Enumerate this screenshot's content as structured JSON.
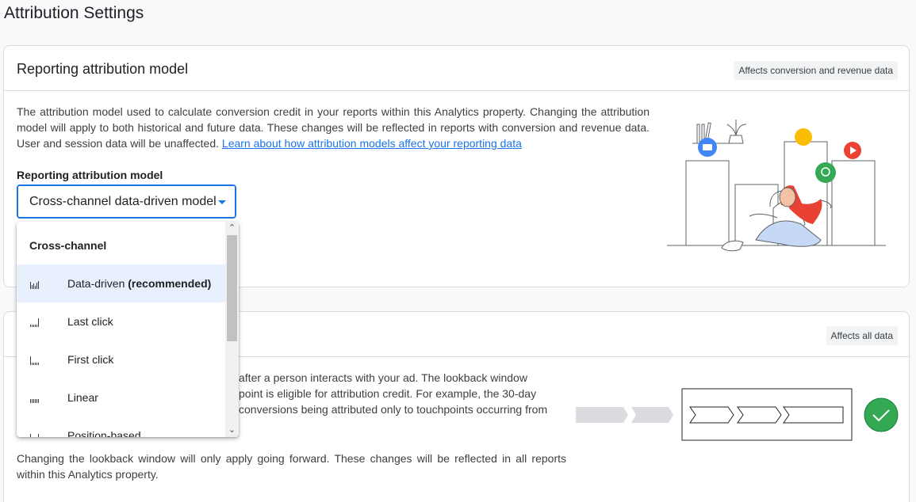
{
  "page": {
    "title": "Attribution Settings"
  },
  "reporting_card": {
    "title": "Reporting attribution model",
    "chip": "Affects conversion and revenue data",
    "description": "The attribution model used to calculate conversion credit in your reports within this Analytics property. Changing the attribution model will apply to both historical and future data. These changes will be reflected in reports with conversion and revenue data. User and session data will be unaffected.",
    "learn_link": "Learn about how attribution models affect your reporting data",
    "field_label": "Reporting attribution model",
    "select_value": "Cross-channel data-driven model"
  },
  "dropdown": {
    "group_label": "Cross-channel",
    "items": [
      {
        "label": "Data-driven",
        "suffix": "(recommended)",
        "icon": "data-driven-bars-icon",
        "selected": true
      },
      {
        "label": "Last click",
        "suffix": "",
        "icon": "last-click-bars-icon",
        "selected": false
      },
      {
        "label": "First click",
        "suffix": "",
        "icon": "first-click-bars-icon",
        "selected": false
      },
      {
        "label": "Linear",
        "suffix": "",
        "icon": "linear-bars-icon",
        "selected": false
      },
      {
        "label": "Position-based",
        "suffix": "",
        "icon": "position-based-bars-icon",
        "selected": false
      }
    ]
  },
  "lookback_card": {
    "chip": "Affects all data",
    "description_partial": "after a person interacts with your ad. The lookback window point is eligible for attribution credit. For example, the 30-day conversions being attributed only to touchpoints occurring from",
    "description_line1": "after a person interacts with your ad. The lookback window",
    "description_line2": "point is eligible for attribution credit. For example, the 30-day",
    "description_line3": "conversions being attributed only to touchpoints occurring from",
    "footer_text": "Changing the lookback window will only apply going forward. These changes will be reflected in all reports within this Analytics property."
  },
  "colors": {
    "accent": "#1a73e8",
    "selected_bg": "#e8f0fe",
    "check_green": "#34a853",
    "chip_bg": "#f1f3f4"
  }
}
